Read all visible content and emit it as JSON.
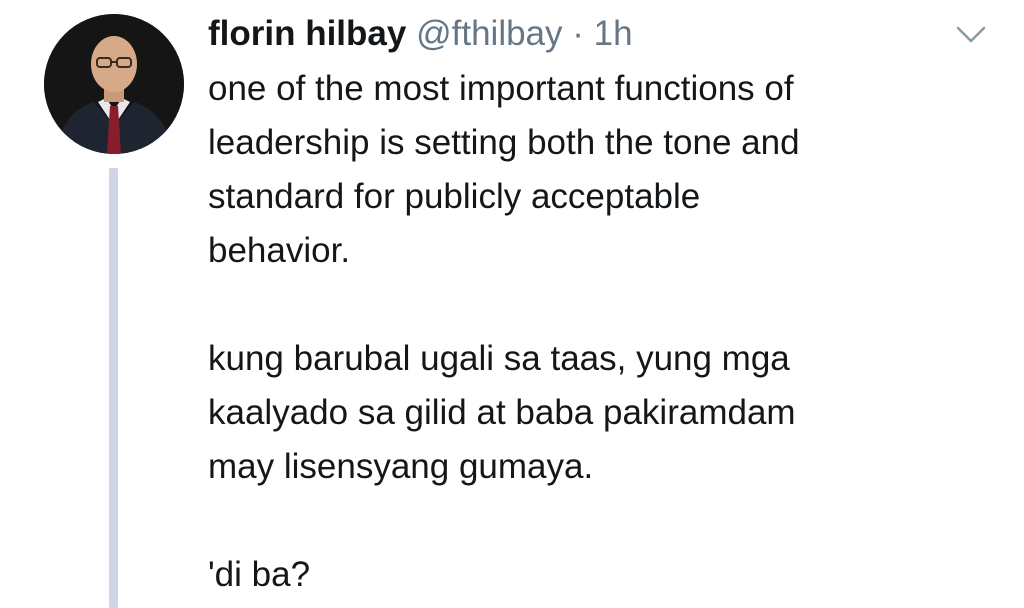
{
  "tweet": {
    "display_name": "florin hilbay",
    "handle": "@fthilbay",
    "separator": "·",
    "time": "1h",
    "lines": [
      "one of the most important functions of",
      "leadership is setting both the tone and",
      "standard for publicly acceptable",
      "behavior.",
      "kung barubal ugali sa taas, yung mga",
      "kaalyado sa gilid at baba pakiramdam",
      "may lisensyang gumaya.",
      "'di ba?"
    ]
  },
  "icons": {
    "menu": "chevron-down-icon",
    "avatar": "profile-photo"
  },
  "colors": {
    "text": "#14171a",
    "secondary": "#657786",
    "thread_line": "#cfd5e3"
  }
}
